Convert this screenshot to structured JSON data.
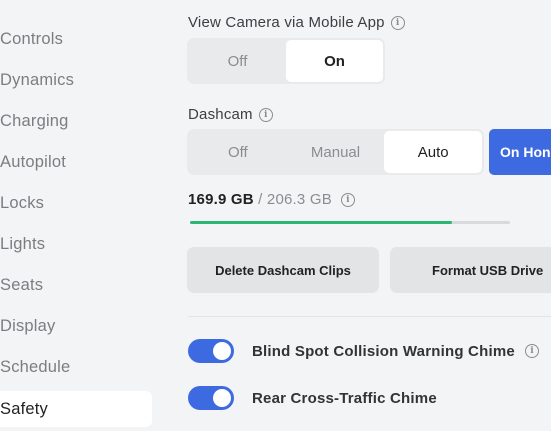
{
  "sidebar": {
    "items": [
      {
        "label": "Controls",
        "active": false
      },
      {
        "label": "Dynamics",
        "active": false
      },
      {
        "label": "Charging",
        "active": false
      },
      {
        "label": "Autopilot",
        "active": false
      },
      {
        "label": "Locks",
        "active": false
      },
      {
        "label": "Lights",
        "active": false
      },
      {
        "label": "Seats",
        "active": false
      },
      {
        "label": "Display",
        "active": false
      },
      {
        "label": "Schedule",
        "active": false
      },
      {
        "label": "Safety",
        "active": true
      }
    ]
  },
  "view_camera": {
    "label": "View Camera via Mobile App",
    "options": [
      "Off",
      "On"
    ],
    "selected": "On"
  },
  "dashcam": {
    "label": "Dashcam",
    "options": [
      "Off",
      "Manual",
      "Auto",
      "On Hon"
    ],
    "selected": "Auto",
    "storage_used": "169.9 GB",
    "storage_separator": " / ",
    "storage_total": "206.3 GB",
    "storage_fraction": 0.82
  },
  "actions": {
    "delete_label": "Delete Dashcam Clips",
    "format_label": "Format USB Drive"
  },
  "toggles": [
    {
      "label": "Blind Spot Collision Warning Chime",
      "on": true,
      "info": true
    },
    {
      "label": "Rear Cross-Traffic Chime",
      "on": true,
      "info": false
    }
  ],
  "colors": {
    "accent": "#3e6ae1",
    "progress": "#2bb673"
  }
}
